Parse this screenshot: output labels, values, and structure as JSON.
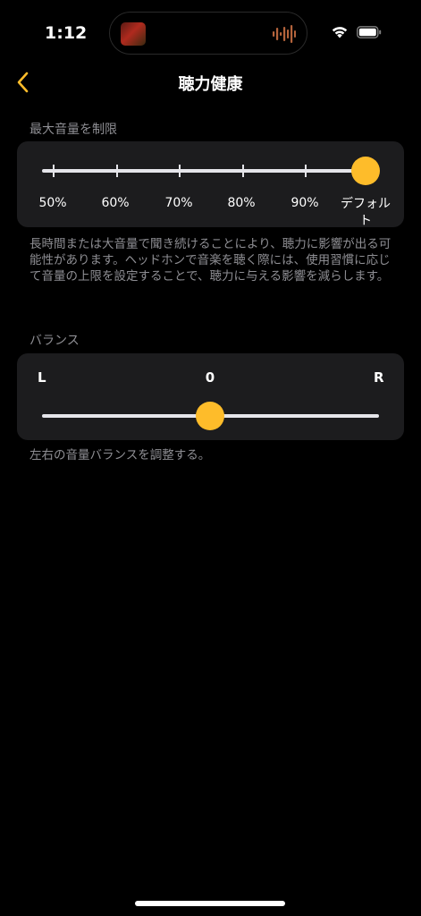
{
  "status_bar": {
    "time": "1:12"
  },
  "nav": {
    "title": "聴力健康",
    "back_icon": "chevron-left-icon"
  },
  "volume_limit": {
    "header": "最大音量を制限",
    "ticks": [
      "50%",
      "60%",
      "70%",
      "80%",
      "90%",
      "デフォルト"
    ],
    "selected": "デフォルト",
    "level_fraction": 1.0,
    "description": "長時間または大音量で聞き続けることにより、聴力に影響が出る可能性があります。ヘッドホンで音楽を聴く際には、使用習慣に応じて音量の上限を設定することで、聴力に与える影響を減らします。"
  },
  "balance": {
    "header": "バランス",
    "left_label": "L",
    "value": "0",
    "right_label": "R",
    "position_fraction": 0.5,
    "description": "左右の音量バランスを調整する。"
  },
  "colors": {
    "accent": "#febc2a",
    "background": "#000000",
    "card": "#1c1c1e",
    "secondary_text": "#8e8e93"
  }
}
